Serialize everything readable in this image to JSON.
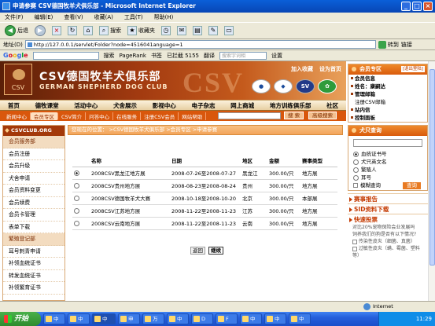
{
  "window": {
    "title": "申请参赛 CSV德国牧羊犬俱乐部 - Microsoft Internet Explorer"
  },
  "menu": [
    "文件(F)",
    "编辑(E)",
    "查看(V)",
    "收藏(A)",
    "工具(T)",
    "帮助(H)"
  ],
  "toolbar": {
    "back": "后退",
    "search": "搜索",
    "favorites": "收藏夹"
  },
  "address": {
    "label": "地址(D)",
    "url": "http://127.0.0.1/servlet/Folder?node=4516041anguage=1",
    "go": "转到",
    "links": "链接"
  },
  "google": {
    "search": "搜索",
    "pagerank": "PageRank",
    "bookmarks": "书签",
    "blocked": "已拦截 5155",
    "translate": "翻译",
    "find_placeholder": "搜索字词相",
    "settings": "设置"
  },
  "header": {
    "cn_title": "CSV德国牧羊犬俱乐部",
    "en_title": "GERMAN SHEPHERD DOG CLUB",
    "csv": "CSV",
    "link_member": "加入收藏",
    "link_home": "设为首页"
  },
  "nav1": [
    "首页",
    "德牧课堂",
    "活动中心",
    "犬舍展示",
    "影视中心",
    "电子杂志",
    "网上商城",
    "地方训练俱乐部",
    "社区"
  ],
  "nav2": [
    "新闻中心",
    "会员专区",
    "CSV简介",
    "问答中心",
    "在线服务",
    "注册CSV会员",
    "网站帮助"
  ],
  "nav2_buttons": {
    "search": "搜 索",
    "advanced": "高级搜索"
  },
  "left": {
    "brand": "CSVCLUB.ORG",
    "items": [
      "会员服务部",
      "会员注册",
      "会员升级",
      "犬舍申请",
      "会员资料变更",
      "会员续费",
      "会员卡管理",
      "表单下载",
      "繁殖登记部",
      "耳号刺青申请",
      "补领血统证书",
      "转发血统证书",
      "补领繁育证书"
    ]
  },
  "main": {
    "breadcrumb": "您现在的位置： >CSV德国牧羊犬俱乐部 >会员专区 >申请参赛",
    "columns": [
      "名称",
      "日期",
      "地区",
      "金额",
      "赛事类型"
    ],
    "rows": [
      {
        "name": "2008CSV黑龙江地方展",
        "date": "2008-07-26至2008-07-27",
        "region": "黑龙江",
        "amount": "300.00/只",
        "type": "地方展",
        "selected": true
      },
      {
        "name": "2008CSV贵州地方展",
        "date": "2008-08-23至2008-08-24",
        "region": "贵州",
        "amount": "300.00/只",
        "type": "地方展",
        "selected": false
      },
      {
        "name": "2008CSV德国牧羊犬大赛",
        "date": "2008-10-18至2008-10-20",
        "region": "北京",
        "amount": "300.00/只",
        "type": "本部展",
        "selected": false
      },
      {
        "name": "2008CSV江苏地方展",
        "date": "2008-11-22至2008-11-23",
        "region": "江苏",
        "amount": "300.00/只",
        "type": "地方展",
        "selected": false
      },
      {
        "name": "2008CSV云南地方展",
        "date": "2008-11-22至2008-11-23",
        "region": "云南",
        "amount": "300.00/只",
        "type": "地方展",
        "selected": false
      }
    ],
    "back": "返回",
    "continue": "继续"
  },
  "right": {
    "member_title": "会员专区",
    "logout": "[退出登陆]",
    "member_links": [
      "会员信息",
      "姓名：康嗣达",
      "管理邮箱",
      "注册CSV邮箱",
      "站内信",
      "控制面板"
    ],
    "dog_title": "犬只查询",
    "options": [
      "血统证书号",
      "犬只英文名",
      "繁殖人",
      "耳号",
      "模糊查询"
    ],
    "search_btn": "查询",
    "news": [
      "赛事报告",
      "SID资料下载",
      "快速投票"
    ],
    "vote_text": "对比20%宠物保险会业发展吗",
    "vote_q": "饲养我们的狗是否有以下情况?",
    "vote_opts": [
      "传染性皮炎（细菌、真菌）",
      "过敏性皮炎（螨、霉菌、塑料等）"
    ]
  },
  "status": {
    "zone": "Internet"
  },
  "taskbar": {
    "start": "开始",
    "tasks": [
      "中",
      "中",
      "中",
      "申",
      "万",
      "中",
      "D",
      "F",
      "中",
      "中",
      "中"
    ],
    "clock": "11:29"
  }
}
